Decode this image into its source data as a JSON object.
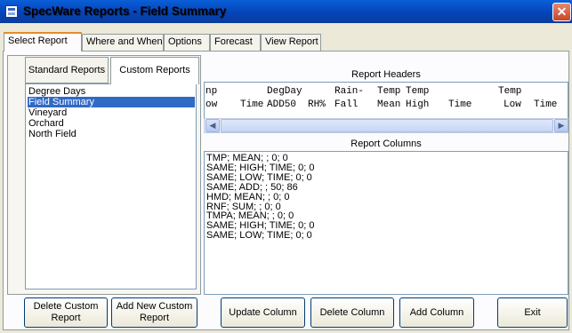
{
  "window": {
    "title": "SpecWare Reports - Field Summary",
    "close_glyph": "✕"
  },
  "tabs": [
    {
      "label": "Select Report",
      "active": true
    },
    {
      "label": "Where and When",
      "active": false
    },
    {
      "label": "Options",
      "active": false
    },
    {
      "label": "Forecast",
      "active": false
    },
    {
      "label": "View Report",
      "active": false
    }
  ],
  "left_pane": {
    "subtabs": [
      {
        "label": "Standard Reports",
        "active": false
      },
      {
        "label": "Custom Reports",
        "active": true
      }
    ],
    "reports": [
      "Degree Days",
      "Field Summary",
      "Vineyard",
      "Orchard",
      "North Field"
    ],
    "selected_report": "Field Summary",
    "delete_button": "Delete Custom Report",
    "add_button": "Add New Custom Report"
  },
  "report_headers": {
    "label": "Report Headers",
    "columns": [
      {
        "top": "np",
        "bottom": "ow"
      },
      {
        "top": "",
        "bottom": "Time"
      },
      {
        "top": "DegDay",
        "bottom": "ADD50"
      },
      {
        "top": "",
        "bottom": "RH%"
      },
      {
        "top": "Rain-",
        "bottom": "Fall"
      },
      {
        "top": "Temp",
        "bottom": "Mean"
      },
      {
        "top": "Temp",
        "bottom": "High"
      },
      {
        "top": "",
        "bottom": "Time"
      },
      {
        "top": "Temp",
        "bottom": "Low"
      },
      {
        "top": "",
        "bottom": "Time"
      }
    ]
  },
  "report_columns": {
    "label": "Report Columns",
    "lines": [
      "TMP; MEAN; ; 0; 0",
      "SAME; HIGH; TIME; 0; 0",
      "SAME; LOW; TIME; 0; 0",
      "SAME; ADD; ; 50; 86",
      "HMD; MEAN; ; 0; 0",
      "RNF; SUM; ; 0; 0",
      "TMPA; MEAN; ; 0; 0",
      "SAME; HIGH; TIME; 0; 0",
      "SAME; LOW; TIME; 0; 0"
    ]
  },
  "buttons": {
    "update_column": "Update Column",
    "delete_column": "Delete Column",
    "add_column": "Add Column",
    "exit": "Exit"
  },
  "scrollbar": {
    "left_glyph": "◀",
    "right_glyph": "▶"
  }
}
